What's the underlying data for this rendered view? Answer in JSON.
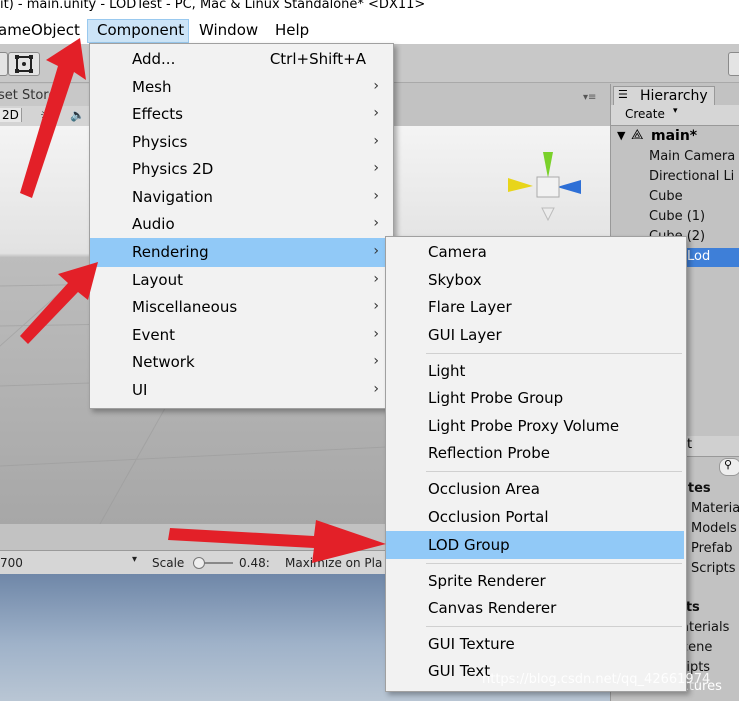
{
  "window": {
    "title": "it) - main.unity - LODTest - PC, Mac & Linux Standalone* <DX11>"
  },
  "menubar": [
    "ameObject",
    "Component",
    "Window",
    "Help"
  ],
  "scene": {
    "tab_label": "set Store",
    "mode_2d": "2D"
  },
  "game_toolbar": {
    "resolution": "700",
    "scale_label": "Scale",
    "scale_value": "0.48:",
    "maximize_label": "Maximize on Pla"
  },
  "hierarchy": {
    "title": "Hierarchy",
    "create_label": "Create",
    "scene_name": "main*",
    "items": [
      "Main Camera",
      "Directional Li",
      "Cube",
      "Cube (1)",
      "Cube (2)",
      "Lod"
    ]
  },
  "project": {
    "tab_label": "t",
    "section_label": "rites",
    "favorites": [
      "Materia",
      "Models",
      "Prefab",
      "Scripts"
    ],
    "assets_label": "ets",
    "assets": [
      "aterials",
      "cene",
      "ripts",
      "xtures"
    ]
  },
  "component_menu": [
    {
      "label": "Add...",
      "shortcut": "Ctrl+Shift+A"
    },
    {
      "label": "Mesh",
      "arrow": "›"
    },
    {
      "label": "Effects",
      "arrow": "›"
    },
    {
      "label": "Physics",
      "arrow": "›"
    },
    {
      "label": "Physics 2D",
      "arrow": "›"
    },
    {
      "label": "Navigation",
      "arrow": "›"
    },
    {
      "label": "Audio",
      "arrow": "›"
    },
    {
      "label": "Rendering",
      "arrow": "›"
    },
    {
      "label": "Layout",
      "arrow": "›"
    },
    {
      "label": "Miscellaneous",
      "arrow": "›"
    },
    {
      "label": "Event",
      "arrow": "›"
    },
    {
      "label": "Network",
      "arrow": "›"
    },
    {
      "label": "UI",
      "arrow": "›"
    }
  ],
  "rendering_submenu": [
    "Camera",
    "Skybox",
    "Flare Layer",
    "GUI Layer",
    "Light",
    "Light Probe Group",
    "Light Probe Proxy Volume",
    "Reflection Probe",
    "Occlusion Area",
    "Occlusion Portal",
    "LOD Group",
    "Sprite Renderer",
    "Canvas Renderer",
    "GUI Texture",
    "GUI Text"
  ],
  "watermark": "https://blog.csdn.net/qq_42661974",
  "colors": {
    "menu_highlight": "#91c9f7",
    "menubar_highlight": "#cce4f7",
    "annotation_arrow": "#e32028",
    "lod_selected": "#3e7fd8"
  }
}
